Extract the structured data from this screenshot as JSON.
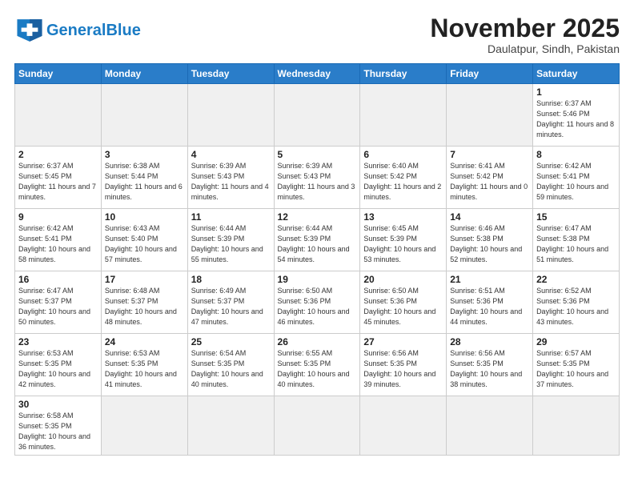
{
  "header": {
    "logo_general": "General",
    "logo_blue": "Blue",
    "month_year": "November 2025",
    "location": "Daulatpur, Sindh, Pakistan"
  },
  "weekdays": [
    "Sunday",
    "Monday",
    "Tuesday",
    "Wednesday",
    "Thursday",
    "Friday",
    "Saturday"
  ],
  "weeks": [
    [
      {
        "day": null,
        "info": null
      },
      {
        "day": null,
        "info": null
      },
      {
        "day": null,
        "info": null
      },
      {
        "day": null,
        "info": null
      },
      {
        "day": null,
        "info": null
      },
      {
        "day": null,
        "info": null
      },
      {
        "day": "1",
        "info": "Sunrise: 6:37 AM\nSunset: 5:46 PM\nDaylight: 11 hours\nand 8 minutes."
      }
    ],
    [
      {
        "day": "2",
        "info": "Sunrise: 6:37 AM\nSunset: 5:45 PM\nDaylight: 11 hours\nand 7 minutes."
      },
      {
        "day": "3",
        "info": "Sunrise: 6:38 AM\nSunset: 5:44 PM\nDaylight: 11 hours\nand 6 minutes."
      },
      {
        "day": "4",
        "info": "Sunrise: 6:39 AM\nSunset: 5:43 PM\nDaylight: 11 hours\nand 4 minutes."
      },
      {
        "day": "5",
        "info": "Sunrise: 6:39 AM\nSunset: 5:43 PM\nDaylight: 11 hours\nand 3 minutes."
      },
      {
        "day": "6",
        "info": "Sunrise: 6:40 AM\nSunset: 5:42 PM\nDaylight: 11 hours\nand 2 minutes."
      },
      {
        "day": "7",
        "info": "Sunrise: 6:41 AM\nSunset: 5:42 PM\nDaylight: 11 hours\nand 0 minutes."
      },
      {
        "day": "8",
        "info": "Sunrise: 6:42 AM\nSunset: 5:41 PM\nDaylight: 10 hours\nand 59 minutes."
      }
    ],
    [
      {
        "day": "9",
        "info": "Sunrise: 6:42 AM\nSunset: 5:41 PM\nDaylight: 10 hours\nand 58 minutes."
      },
      {
        "day": "10",
        "info": "Sunrise: 6:43 AM\nSunset: 5:40 PM\nDaylight: 10 hours\nand 57 minutes."
      },
      {
        "day": "11",
        "info": "Sunrise: 6:44 AM\nSunset: 5:39 PM\nDaylight: 10 hours\nand 55 minutes."
      },
      {
        "day": "12",
        "info": "Sunrise: 6:44 AM\nSunset: 5:39 PM\nDaylight: 10 hours\nand 54 minutes."
      },
      {
        "day": "13",
        "info": "Sunrise: 6:45 AM\nSunset: 5:39 PM\nDaylight: 10 hours\nand 53 minutes."
      },
      {
        "day": "14",
        "info": "Sunrise: 6:46 AM\nSunset: 5:38 PM\nDaylight: 10 hours\nand 52 minutes."
      },
      {
        "day": "15",
        "info": "Sunrise: 6:47 AM\nSunset: 5:38 PM\nDaylight: 10 hours\nand 51 minutes."
      }
    ],
    [
      {
        "day": "16",
        "info": "Sunrise: 6:47 AM\nSunset: 5:37 PM\nDaylight: 10 hours\nand 50 minutes."
      },
      {
        "day": "17",
        "info": "Sunrise: 6:48 AM\nSunset: 5:37 PM\nDaylight: 10 hours\nand 48 minutes."
      },
      {
        "day": "18",
        "info": "Sunrise: 6:49 AM\nSunset: 5:37 PM\nDaylight: 10 hours\nand 47 minutes."
      },
      {
        "day": "19",
        "info": "Sunrise: 6:50 AM\nSunset: 5:36 PM\nDaylight: 10 hours\nand 46 minutes."
      },
      {
        "day": "20",
        "info": "Sunrise: 6:50 AM\nSunset: 5:36 PM\nDaylight: 10 hours\nand 45 minutes."
      },
      {
        "day": "21",
        "info": "Sunrise: 6:51 AM\nSunset: 5:36 PM\nDaylight: 10 hours\nand 44 minutes."
      },
      {
        "day": "22",
        "info": "Sunrise: 6:52 AM\nSunset: 5:36 PM\nDaylight: 10 hours\nand 43 minutes."
      }
    ],
    [
      {
        "day": "23",
        "info": "Sunrise: 6:53 AM\nSunset: 5:35 PM\nDaylight: 10 hours\nand 42 minutes."
      },
      {
        "day": "24",
        "info": "Sunrise: 6:53 AM\nSunset: 5:35 PM\nDaylight: 10 hours\nand 41 minutes."
      },
      {
        "day": "25",
        "info": "Sunrise: 6:54 AM\nSunset: 5:35 PM\nDaylight: 10 hours\nand 40 minutes."
      },
      {
        "day": "26",
        "info": "Sunrise: 6:55 AM\nSunset: 5:35 PM\nDaylight: 10 hours\nand 40 minutes."
      },
      {
        "day": "27",
        "info": "Sunrise: 6:56 AM\nSunset: 5:35 PM\nDaylight: 10 hours\nand 39 minutes."
      },
      {
        "day": "28",
        "info": "Sunrise: 6:56 AM\nSunset: 5:35 PM\nDaylight: 10 hours\nand 38 minutes."
      },
      {
        "day": "29",
        "info": "Sunrise: 6:57 AM\nSunset: 5:35 PM\nDaylight: 10 hours\nand 37 minutes."
      }
    ],
    [
      {
        "day": "30",
        "info": "Sunrise: 6:58 AM\nSunset: 5:35 PM\nDaylight: 10 hours\nand 36 minutes."
      },
      {
        "day": null,
        "info": null
      },
      {
        "day": null,
        "info": null
      },
      {
        "day": null,
        "info": null
      },
      {
        "day": null,
        "info": null
      },
      {
        "day": null,
        "info": null
      },
      {
        "day": null,
        "info": null
      }
    ]
  ]
}
